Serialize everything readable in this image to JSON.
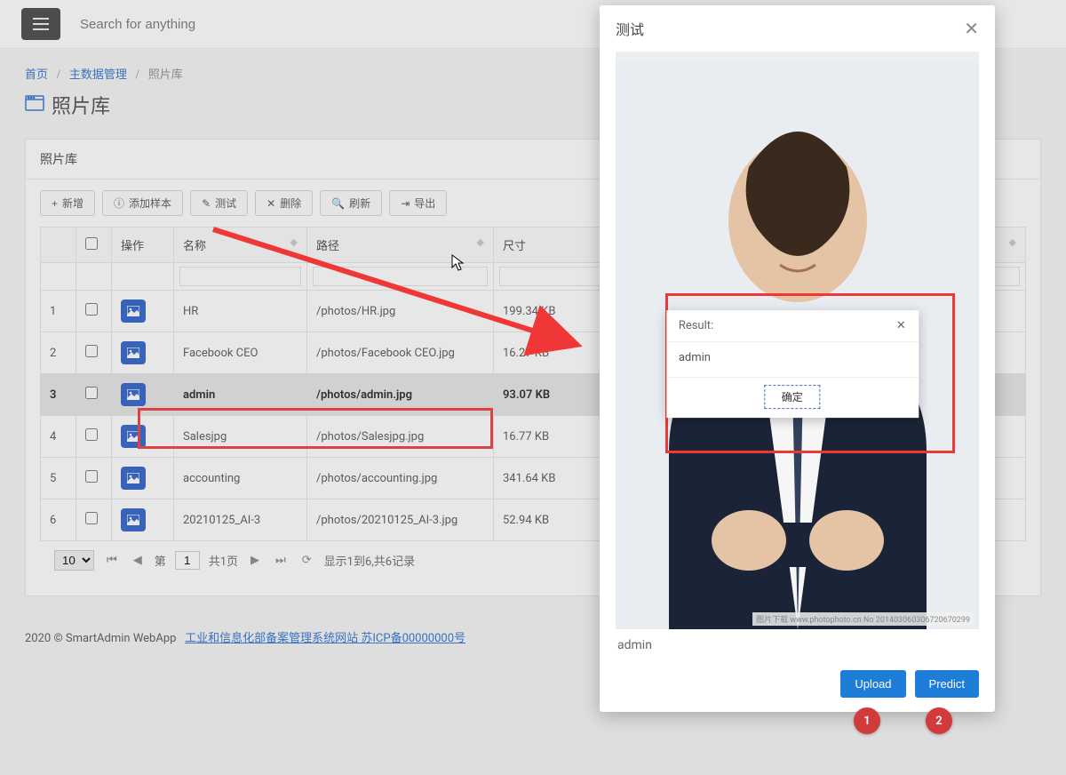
{
  "topbar": {
    "search_placeholder": "Search for anything"
  },
  "breadcrumb": {
    "home": "首页",
    "l1": "主数据管理",
    "l2": "照片库"
  },
  "page": {
    "title": "照片库",
    "panel_title": "照片库"
  },
  "toolbar": {
    "add": "新增",
    "sample": "添加样本",
    "test": "测试",
    "delete": "删除",
    "refresh": "刷新",
    "export": "导出"
  },
  "columns": {
    "idx": "",
    "chk": "",
    "op": "操作",
    "name": "名称",
    "path": "路径",
    "size": "尺寸"
  },
  "rows": [
    {
      "idx": "1",
      "name": "HR",
      "path": "/photos/HR.jpg",
      "size": "199.34 KB"
    },
    {
      "idx": "2",
      "name": "Facebook CEO",
      "path": "/photos/Facebook CEO.jpg",
      "size": "16.27 KB"
    },
    {
      "idx": "3",
      "name": "admin",
      "path": "/photos/admin.jpg",
      "size": "93.07 KB"
    },
    {
      "idx": "4",
      "name": "Salesjpg",
      "path": "/photos/Salesjpg.jpg",
      "size": "16.77 KB"
    },
    {
      "idx": "5",
      "name": "accounting",
      "path": "/photos/accounting.jpg",
      "size": "341.64 KB"
    },
    {
      "idx": "6",
      "name": "20210125_AI-3",
      "path": "/photos/20210125_AI-3.jpg",
      "size": "52.94 KB"
    }
  ],
  "pager": {
    "pagesize": "10",
    "label_page": "第",
    "current": "1",
    "total_pages": "共1页",
    "info": "显示1到6,共6记录"
  },
  "footer": {
    "copy": "2020 © SmartAdmin WebApp",
    "link": "工业和信息化部备案管理系统网站 苏ICP备00000000号"
  },
  "modal": {
    "title": "测试",
    "name_line": "admin",
    "upload": "Upload",
    "predict": "Predict",
    "watermark": "图片下载 www.photophoto.cn  No 201403060306720670299"
  },
  "result": {
    "title": "Result:",
    "value": "admin",
    "ok": "确定"
  },
  "badges": {
    "one": "1",
    "two": "2"
  }
}
